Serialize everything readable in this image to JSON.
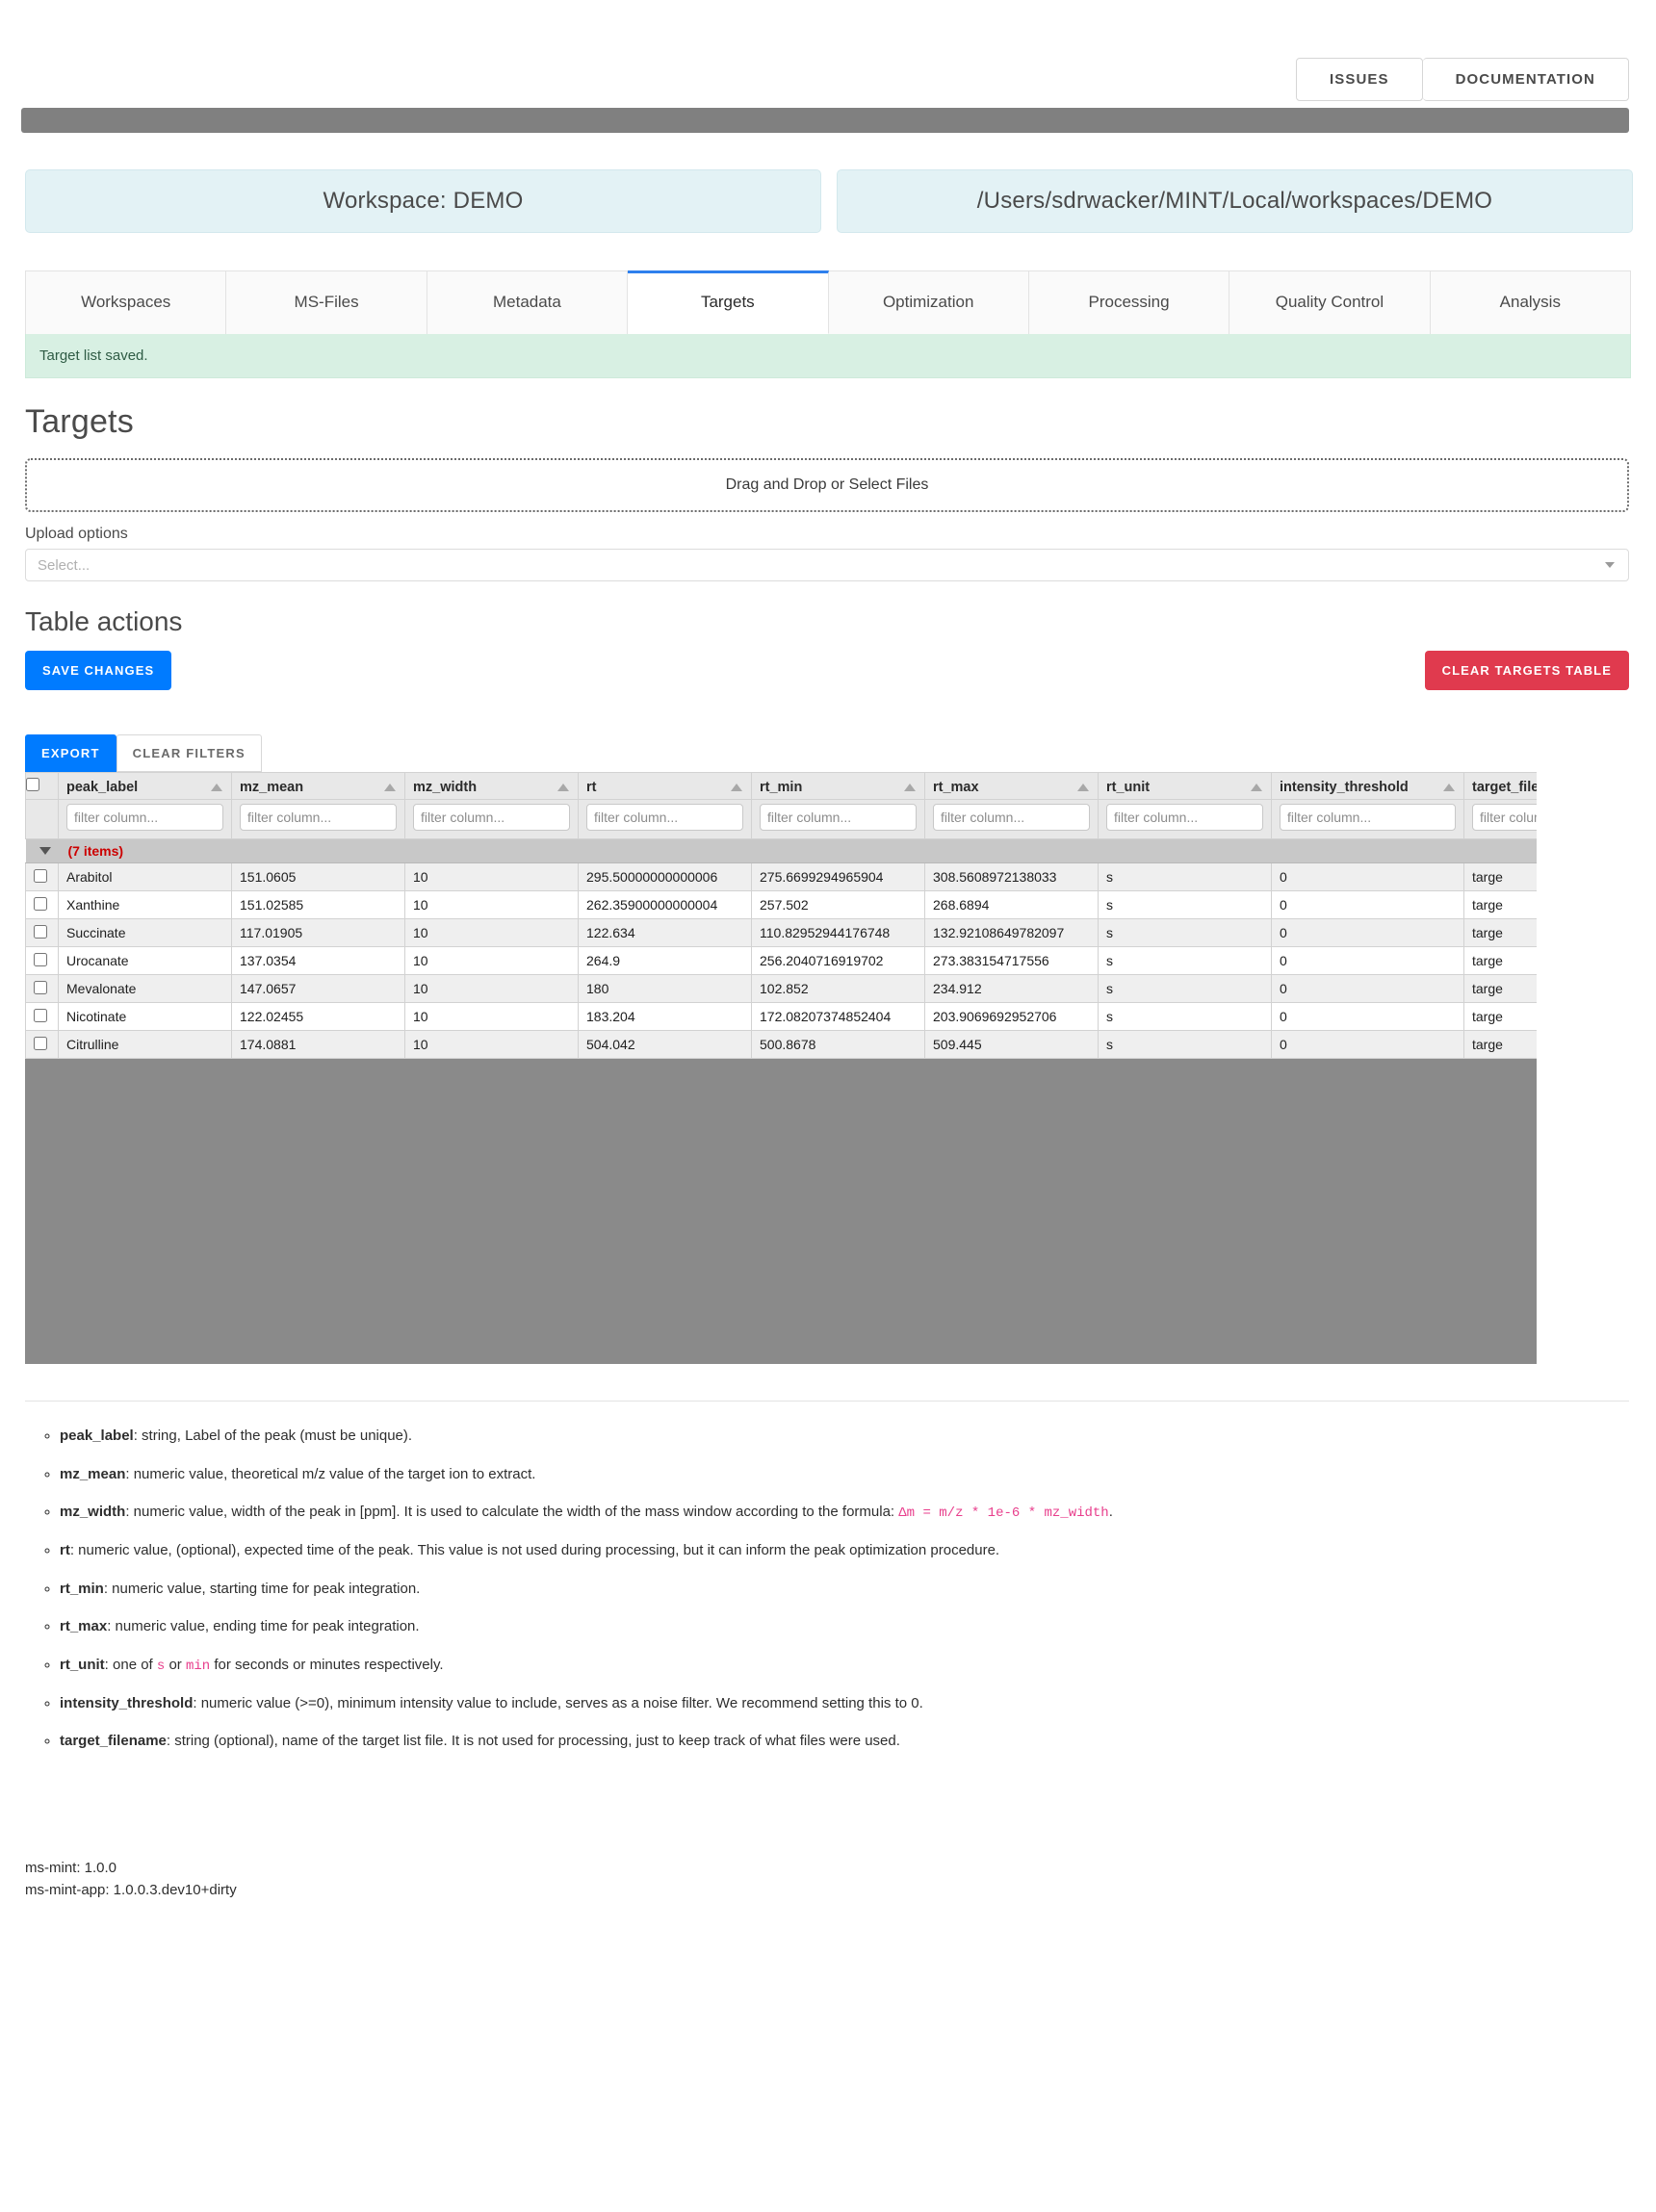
{
  "topbar": {
    "issues_label": "ISSUES",
    "documentation_label": "DOCUMENTATION"
  },
  "workspace": {
    "name_label": "Workspace: DEMO",
    "path_label": "/Users/sdrwacker/MINT/Local/workspaces/DEMO"
  },
  "tabs": [
    {
      "label": "Workspaces",
      "active": false
    },
    {
      "label": "MS-Files",
      "active": false
    },
    {
      "label": "Metadata",
      "active": false
    },
    {
      "label": "Targets",
      "active": true
    },
    {
      "label": "Optimization",
      "active": false
    },
    {
      "label": "Processing",
      "active": false
    },
    {
      "label": "Quality Control",
      "active": false
    },
    {
      "label": "Analysis",
      "active": false
    }
  ],
  "alert": {
    "text": "Target list saved."
  },
  "page_title": "Targets",
  "upload": {
    "dropzone_label": "Drag and Drop or Select Files",
    "options_label": "Upload options",
    "select_placeholder": "Select..."
  },
  "table_actions": {
    "heading": "Table actions",
    "save_label": "SAVE CHANGES",
    "clear_label": "CLEAR TARGETS TABLE"
  },
  "table_toolbar": {
    "export_label": "EXPORT",
    "clear_filters_label": "CLEAR FILTERS"
  },
  "table": {
    "filter_placeholder": "filter column...",
    "items_count_label": "(7 items)",
    "columns": [
      "peak_label",
      "mz_mean",
      "mz_width",
      "rt",
      "rt_min",
      "rt_max",
      "rt_unit",
      "intensity_threshold",
      "target_filename"
    ],
    "rows": [
      {
        "peak_label": "Arabitol",
        "mz_mean": "151.0605",
        "mz_width": "10",
        "rt": "295.50000000000006",
        "rt_min": "275.6699294965904",
        "rt_max": "308.5608972138033",
        "rt_unit": "s",
        "intensity_threshold": "0",
        "target_filename": "targe"
      },
      {
        "peak_label": "Xanthine",
        "mz_mean": "151.02585",
        "mz_width": "10",
        "rt": "262.35900000000004",
        "rt_min": "257.502",
        "rt_max": "268.6894",
        "rt_unit": "s",
        "intensity_threshold": "0",
        "target_filename": "targe"
      },
      {
        "peak_label": "Succinate",
        "mz_mean": "117.01905",
        "mz_width": "10",
        "rt": "122.634",
        "rt_min": "110.82952944176748",
        "rt_max": "132.92108649782097",
        "rt_unit": "s",
        "intensity_threshold": "0",
        "target_filename": "targe"
      },
      {
        "peak_label": "Urocanate",
        "mz_mean": "137.0354",
        "mz_width": "10",
        "rt": "264.9",
        "rt_min": "256.2040716919702",
        "rt_max": "273.383154717556",
        "rt_unit": "s",
        "intensity_threshold": "0",
        "target_filename": "targe"
      },
      {
        "peak_label": "Mevalonate",
        "mz_mean": "147.0657",
        "mz_width": "10",
        "rt": "180",
        "rt_min": "102.852",
        "rt_max": "234.912",
        "rt_unit": "s",
        "intensity_threshold": "0",
        "target_filename": "targe"
      },
      {
        "peak_label": "Nicotinate",
        "mz_mean": "122.02455",
        "mz_width": "10",
        "rt": "183.204",
        "rt_min": "172.08207374852404",
        "rt_max": "203.9069692952706",
        "rt_unit": "s",
        "intensity_threshold": "0",
        "target_filename": "targe"
      },
      {
        "peak_label": "Citrulline",
        "mz_mean": "174.0881",
        "mz_width": "10",
        "rt": "504.042",
        "rt_min": "500.8678",
        "rt_max": "509.445",
        "rt_unit": "s",
        "intensity_threshold": "0",
        "target_filename": "targe"
      }
    ]
  },
  "docs": [
    {
      "term": "peak_label",
      "text": ": string, Label of the peak (must be unique).",
      "code": "",
      "tail": ""
    },
    {
      "term": "mz_mean",
      "text": ": numeric value, theoretical m/z value of the target ion to extract.",
      "code": "",
      "tail": ""
    },
    {
      "term": "mz_width",
      "text": ": numeric value, width of the peak in [ppm]. It is used to calculate the width of the mass window according to the formula: ",
      "code": "Δm = m/z * 1e-6 * mz_width",
      "tail": "."
    },
    {
      "term": "rt",
      "text": ": numeric value, (optional), expected time of the peak. This value is not used during processing, but it can inform the peak optimization procedure.",
      "code": "",
      "tail": ""
    },
    {
      "term": "rt_min",
      "text": ": numeric value, starting time for peak integration.",
      "code": "",
      "tail": ""
    },
    {
      "term": "rt_max",
      "text": ": numeric value, ending time for peak integration.",
      "code": "",
      "tail": ""
    },
    {
      "term": "rt_unit",
      "text": ": one of ",
      "code": "s",
      "text2": " or ",
      "code2": "min",
      "tail": " for seconds or minutes respectively."
    },
    {
      "term": "intensity_threshold",
      "text": ": numeric value (>=0), minimum intensity value to include, serves as a noise filter. We recommend setting this to 0.",
      "code": "",
      "tail": ""
    },
    {
      "term": "target_filename",
      "text": ": string (optional), name of the target list file. It is not used for processing, just to keep track of what files were used.",
      "code": "",
      "tail": ""
    }
  ],
  "footer": {
    "line1": "ms-mint: 1.0.0",
    "line2": "ms-mint-app: 1.0.0.3.dev10+dirty"
  },
  "colors": {
    "accent": "#007bff",
    "danger": "#e03a4e",
    "alert_bg": "#d8f0e3",
    "workspace_bg": "#e3f2f5",
    "code_pink": "#e83e8c",
    "items_red": "#cc0000"
  }
}
